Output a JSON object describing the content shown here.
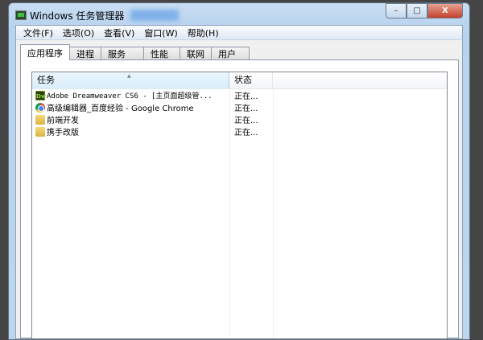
{
  "window": {
    "title": "Windows 任务管理器",
    "controls": {
      "minimize": "–",
      "maximize": "□",
      "close": "X"
    }
  },
  "menu": [
    "文件(F)",
    "选项(O)",
    "查看(V)",
    "窗口(W)",
    "帮助(H)"
  ],
  "tabs": [
    "应用程序",
    "进程",
    "服务",
    "性能",
    "联网",
    "用户"
  ],
  "columns": {
    "task": "任务",
    "status": "状态"
  },
  "rows": [
    {
      "icon": "dreamweaver-icon",
      "icon_text": "Dw",
      "name": "Adobe Dreamweaver CS6 - [主页面超级管...",
      "status": "正在..."
    },
    {
      "icon": "chrome-icon",
      "name": "高级编辑器_百度经验 - Google Chrome",
      "status": "正在..."
    },
    {
      "icon": "folder-icon",
      "name": "前端开发",
      "status": "正在..."
    },
    {
      "icon": "folder-icon",
      "name": "携手改版",
      "status": "正在..."
    }
  ]
}
